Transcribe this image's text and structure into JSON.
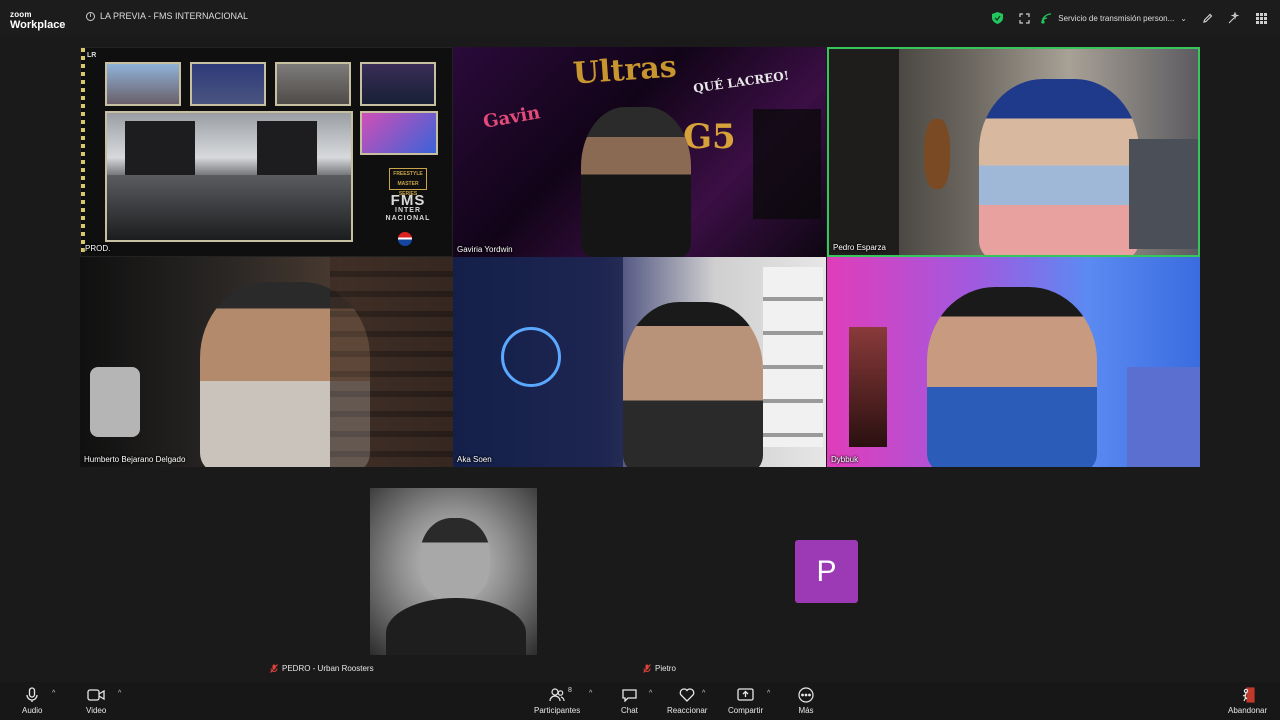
{
  "app": {
    "brand_top": "zoom",
    "brand_bottom": "Workplace",
    "meeting_title": "LA PREVIA - FMS INTERNACIONAL"
  },
  "topbar": {
    "stream_label": "Servicio de transmisión person...",
    "icons": [
      "shield-icon",
      "fullscreen-icon",
      "broadcast-icon",
      "pen-icon",
      "sparkle-icon",
      "apps-grid-icon"
    ],
    "security_color": "#22c55e"
  },
  "tiles": [
    {
      "name": "PROD."
    },
    {
      "name": "Gaviria Yordwin"
    },
    {
      "name": "Pedro Esparza",
      "active_speaker_color": "#37c55e"
    },
    {
      "name": "Humberto Bejarano Delgado"
    },
    {
      "name": "Aka Soen"
    },
    {
      "name": "Dybbuk"
    }
  ],
  "prod_tile": {
    "logo_badge": "FREESTYLE MASTER SERIES",
    "logo_big": "FMS",
    "logo_line2": "INTER",
    "logo_line3": "NACIONAL"
  },
  "bottom_participants": [
    {
      "name": "PEDRO - Urban Roosters",
      "muted": true
    },
    {
      "name": "Pietro",
      "muted": true,
      "avatar_letter": "P",
      "avatar_color": "#9c3ab5"
    }
  ],
  "toolbar": {
    "audio": "Audio",
    "video": "Video",
    "participants": "Participantes",
    "participants_count": "8",
    "chat": "Chat",
    "react": "Reaccionar",
    "share": "Compartir",
    "more": "Más",
    "leave": "Abandonar"
  }
}
